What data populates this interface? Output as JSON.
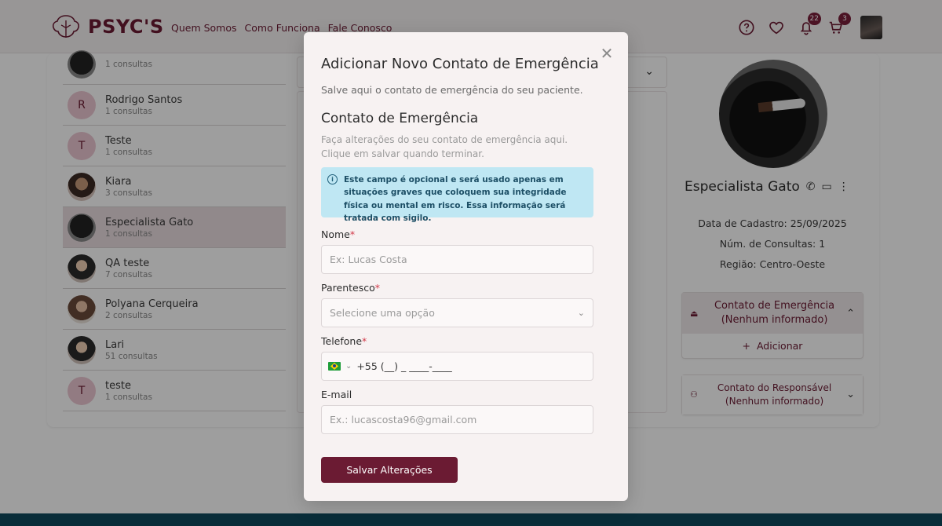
{
  "header": {
    "brand": "PSYC'S",
    "nav": [
      "Quem Somos",
      "Como Funciona",
      "Fale Conosco"
    ],
    "notifications_count": "22",
    "cart_count": "3"
  },
  "patients": [
    {
      "initial": "",
      "name": "",
      "count": "1 consultas",
      "avatar": "photo3"
    },
    {
      "initial": "R",
      "name": "Rodrigo Santos",
      "count": "1 consultas",
      "avatar": ""
    },
    {
      "initial": "T",
      "name": "Teste",
      "count": "1 consultas",
      "avatar": ""
    },
    {
      "initial": "",
      "name": "Kiara",
      "count": "3 consultas",
      "avatar": "photo"
    },
    {
      "initial": "",
      "name": "Especialista Gato",
      "count": "1 consultas",
      "avatar": "photo3",
      "selected": true
    },
    {
      "initial": "",
      "name": "QA teste",
      "count": "7 consultas",
      "avatar": "photo2"
    },
    {
      "initial": "",
      "name": "Polyana Cerqueira",
      "count": "2 consultas",
      "avatar": "photo4"
    },
    {
      "initial": "",
      "name": "Lari",
      "count": "51 consultas",
      "avatar": "photo2"
    },
    {
      "initial": "T",
      "name": "teste",
      "count": "1 consultas",
      "avatar": ""
    }
  ],
  "profile": {
    "name": "Especialista Gato",
    "registration": "Data de Cadastro: 25/09/2025",
    "consultations": "Núm. de Consultas: 1",
    "region": "Região: Centro-Oeste",
    "emergency_title": "Contato de Emergência",
    "emergency_status": "(Nenhum informado)",
    "add_label": "Adicionar",
    "guardian_title": "Contato do Responsável",
    "guardian_status": "(Nenhum informado)"
  },
  "modal": {
    "title": "Adicionar Novo Contato de Emergência",
    "subtitle": "Salve aqui o contato de emergência do seu paciente.",
    "section_title": "Contato de Emergência",
    "section_desc": "Faça alterações do seu contato de emergência aqui. Clique em salvar quando terminar.",
    "alert": "Este campo é opcional e será usado apenas em situações graves que coloquem sua integridade física ou mental em risco. Essa informação será tratada com sigilo.",
    "fields": {
      "name_label": "Nome",
      "name_placeholder": "Ex: Lucas Costa",
      "relation_label": "Parentesco",
      "relation_placeholder": "Selecione uma opção",
      "phone_label": "Telefone",
      "phone_value": "+55 (__) _ ____-____",
      "email_label": "E-mail",
      "email_placeholder": "Ex.: lucascosta96@gmail.com"
    },
    "save_label": "Salvar Alterações"
  },
  "colors": {
    "brand": "#6b1b33",
    "alert_bg": "#bfe7f3",
    "footer": "#0f4a5c"
  }
}
